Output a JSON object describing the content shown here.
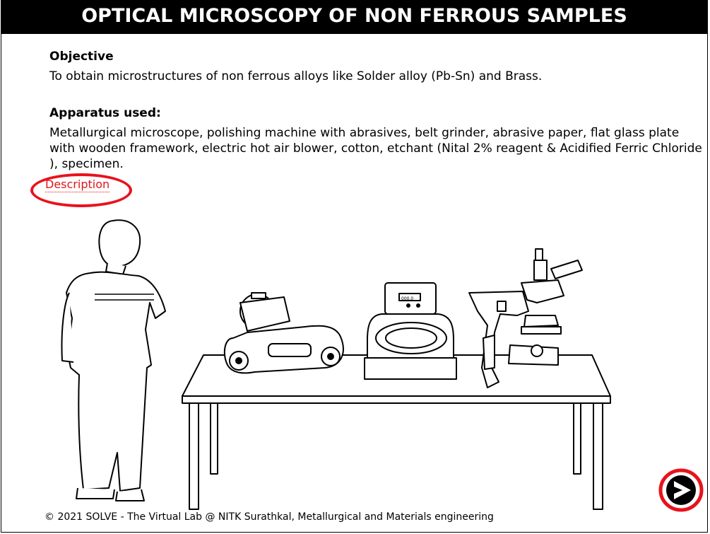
{
  "header": {
    "title": "OPTICAL MICROSCOPY OF NON FERROUS SAMPLES"
  },
  "objective": {
    "heading": "Objective",
    "text": "To obtain microstructures of non ferrous alloys like Solder alloy (Pb-Sn) and Brass."
  },
  "apparatus": {
    "heading": "Apparatus used:",
    "text": "Metallurgical microscope, polishing machine with abrasives, belt grinder, abrasive paper, flat glass plate with wooden framework, electric hot air blower, cotton, etchant (Nital 2% reagent & Acidified Ferric Chloride ), specimen."
  },
  "description_link": {
    "label": "Description"
  },
  "polisher_display": {
    "label": "000.0"
  },
  "footer": {
    "text": "© 2021 SOLVE - The Virtual Lab @ NITK Surathkal, Metallurgical and Materials engineering"
  },
  "next_button": {
    "icon": "arrow-right-icon"
  },
  "colors": {
    "title_bg": "#000000",
    "link": "#e0161c",
    "highlight_ring": "#e8121c"
  }
}
